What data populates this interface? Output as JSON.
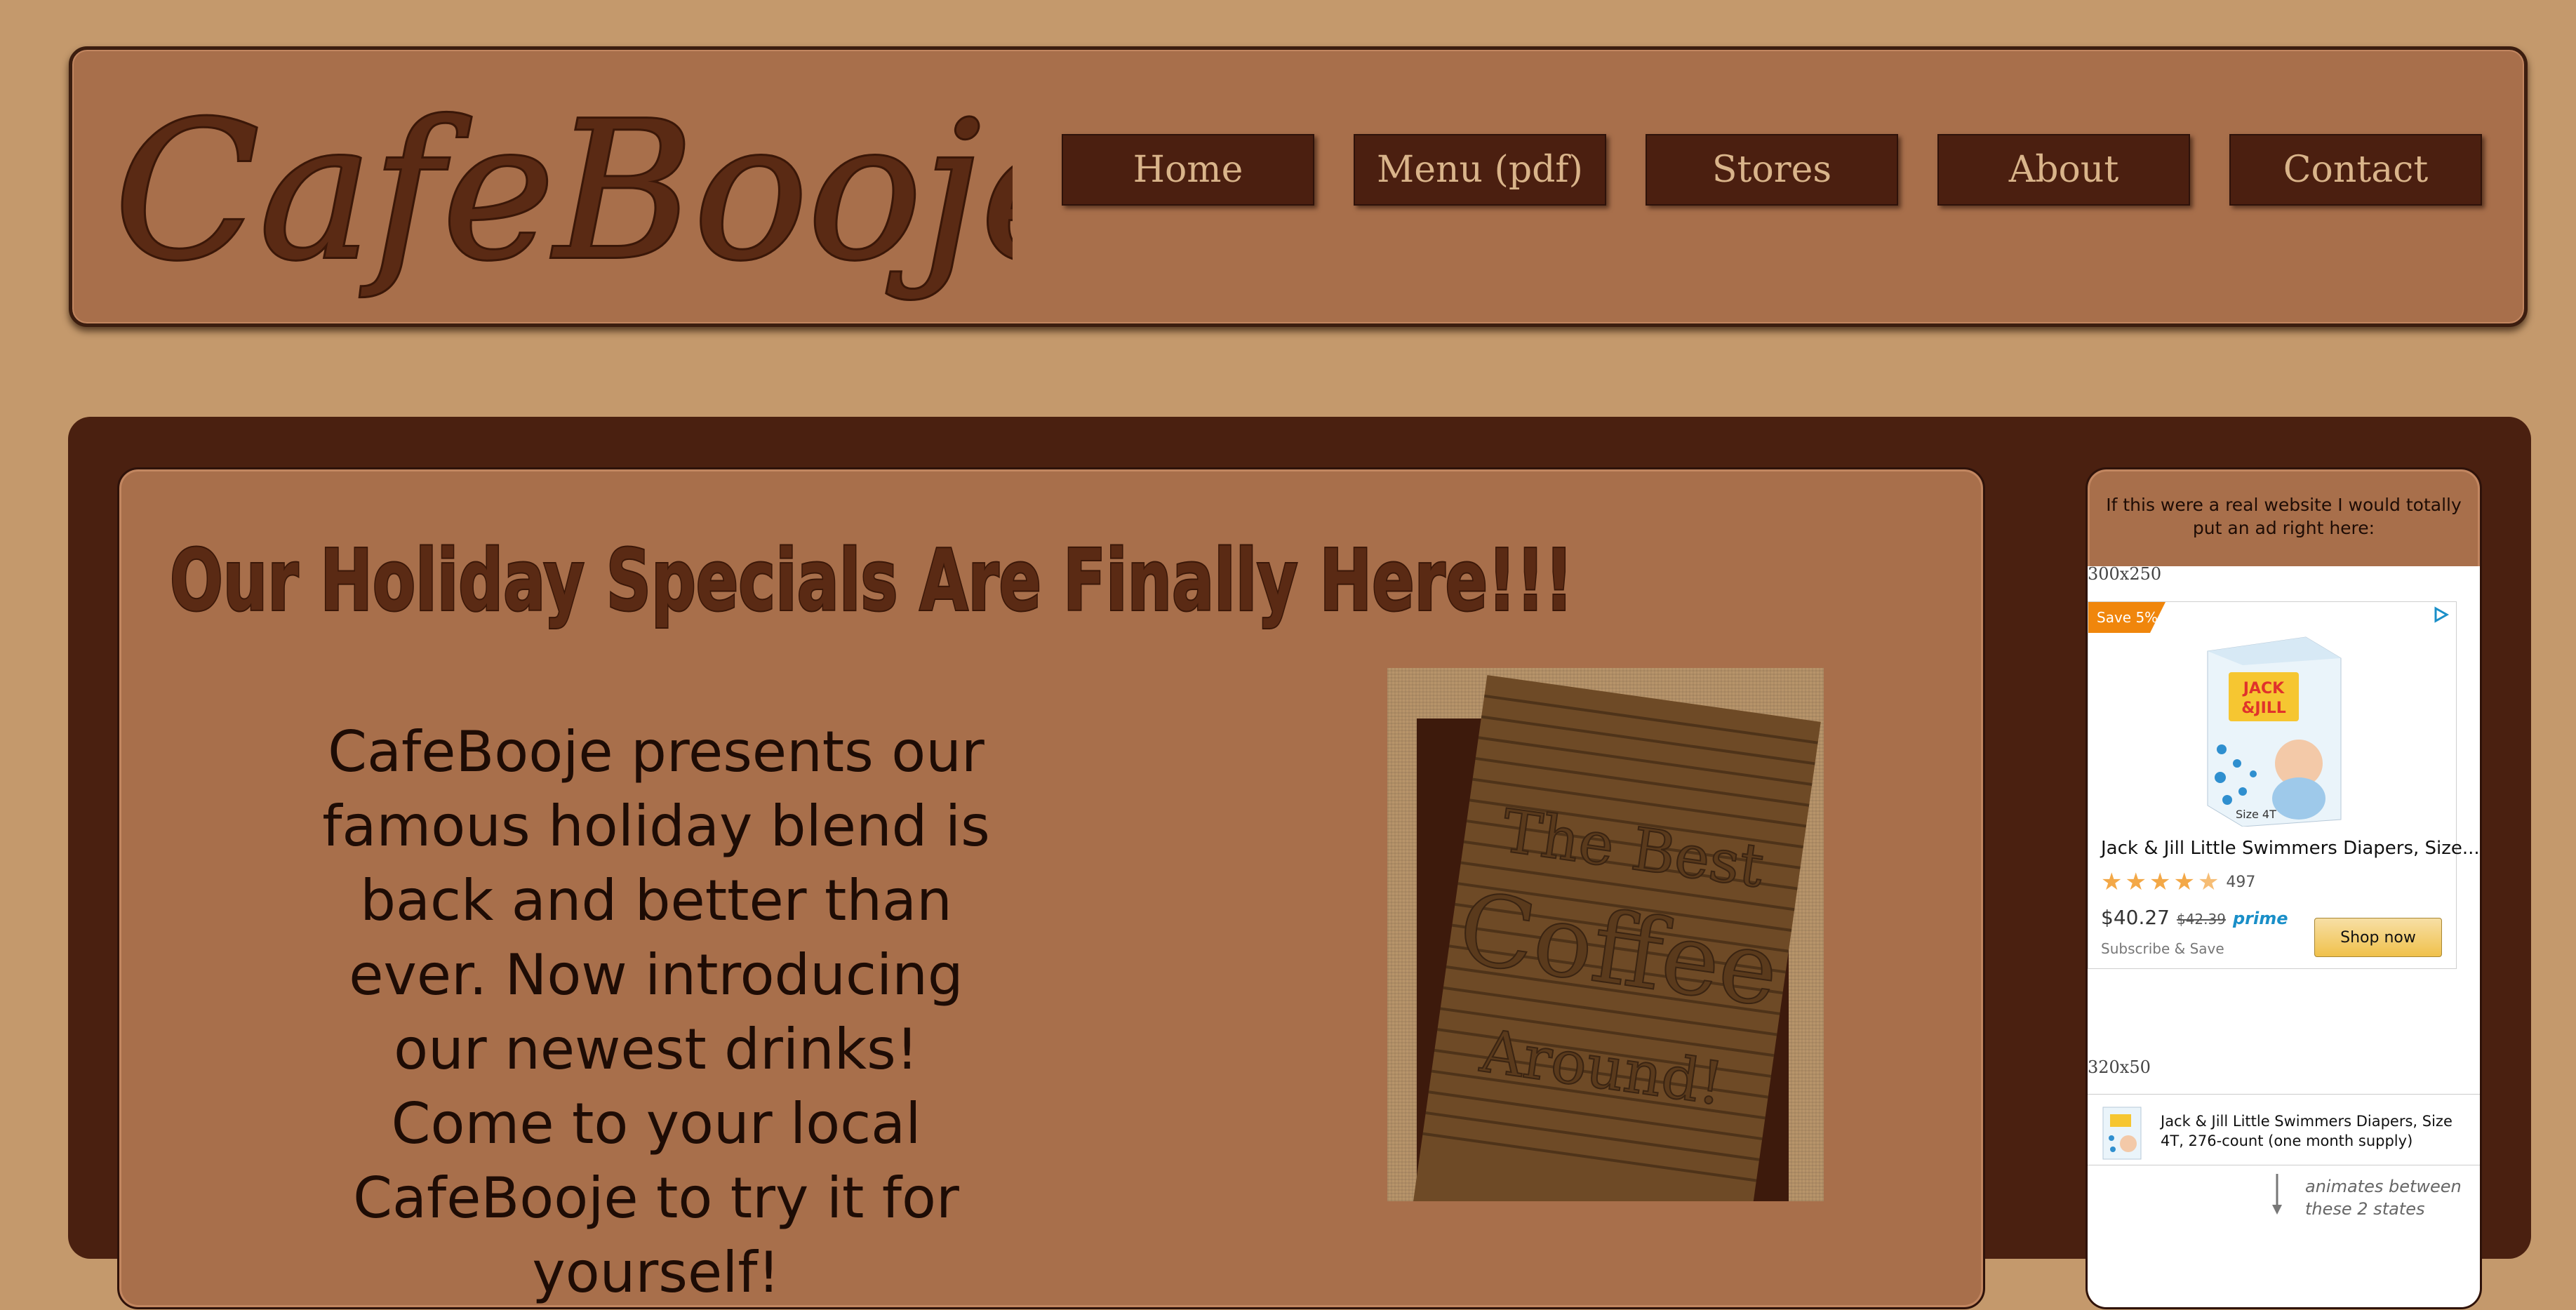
{
  "brand": {
    "logo_text": "CafeBooje"
  },
  "nav": {
    "items": [
      "Home",
      "Menu (pdf)",
      "Stores",
      "About",
      "Contact"
    ]
  },
  "main": {
    "headline": "Our Holiday Specials Are Finally Here!!!",
    "body": "CafeBooje presents our famous holiday blend is back and better than ever. Now introducing our newest drinks! Come to your local CafeBooje to try it for yourself!",
    "promo_image": {
      "line1": "The Best",
      "line2": "Coffee",
      "line3": "Around!"
    }
  },
  "sidebar": {
    "ad_note": "If this were a real website I would totally put an ad right here:",
    "ad1": {
      "size_label": "300x250",
      "badge": "Save 5%",
      "product_title": "Jack & Jill Little Swimmers Diapers, Size...",
      "rating_stars": 4.5,
      "rating_count": "497",
      "price": "$40.27",
      "old_price": "$42.39",
      "prime": "prime",
      "subscribe": "Subscribe & Save",
      "button": "Shop now",
      "package_brand": "JACK & JILL",
      "package_size": "Size 4T"
    },
    "ad2": {
      "size_label": "320x50",
      "product_title": "Jack & Jill Little Swimmers Diapers, Size 4T, 276-count (one month supply)"
    },
    "animates_note": "animates between these 2 states"
  },
  "colors": {
    "page_bg": "#c4996c",
    "panel": "#a86f4b",
    "dark_brown": "#4a2010",
    "nav_text": "#d9b48a",
    "amazon_orange": "#f0860c"
  }
}
